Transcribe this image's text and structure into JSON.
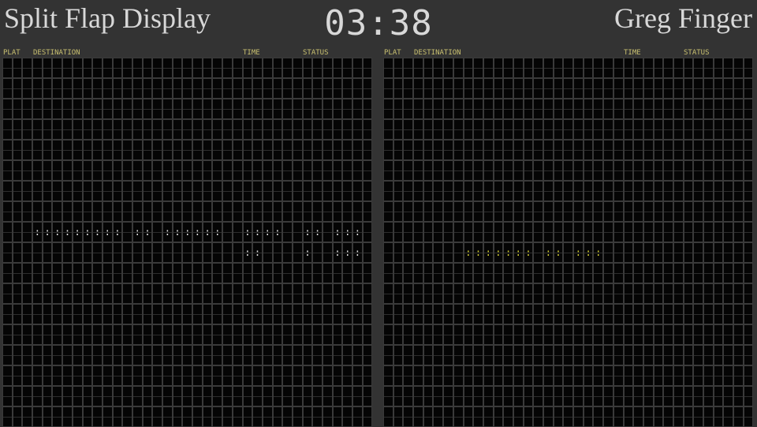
{
  "header": {
    "app_title": "Split Flap Display",
    "clock": "03:38",
    "user_name": "Greg Finger"
  },
  "columns": {
    "plat": "PLAT",
    "destination": "DESTINATION",
    "time": "TIME",
    "status": "STATUS"
  },
  "boards": [
    {
      "name": "left",
      "rows": 18,
      "cols": 37,
      "text_color": "#eeeeee",
      "lines": {
        "8": "   ::::::::: :: ::::::  ::::  :: :::  ",
        "9": "                        ::    :  :::  "
      }
    },
    {
      "name": "right",
      "rows": 18,
      "cols": 37,
      "text_color": "#e2dc3a",
      "lines": {
        "9": "        ::::::: :: :::               "
      }
    }
  ]
}
